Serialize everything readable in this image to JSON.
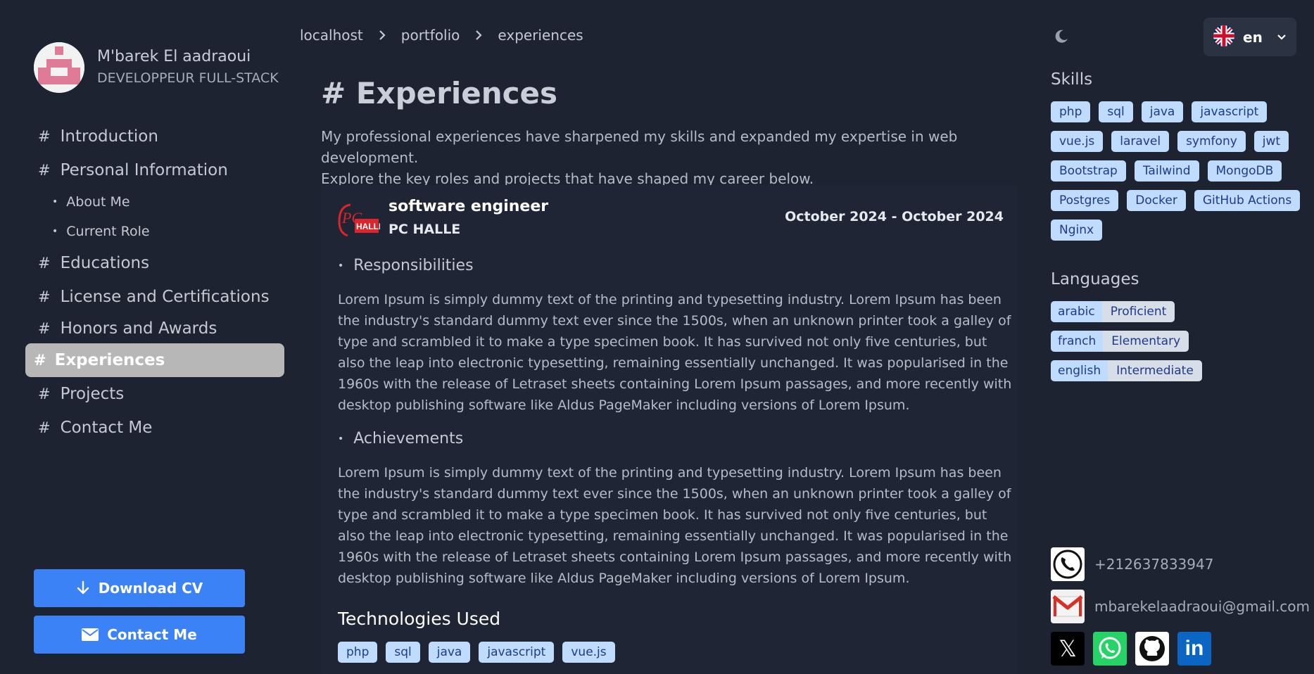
{
  "profile": {
    "name": "M'barek El aadraoui",
    "role": "DEVELOPPEUR FULL-STACK"
  },
  "nav": {
    "hash": "#",
    "bullet": "•",
    "items": [
      {
        "label": "Introduction"
      },
      {
        "label": "Personal Information"
      },
      {
        "label": "About Me"
      },
      {
        "label": "Current Role"
      },
      {
        "label": "Educations"
      },
      {
        "label": "License and Certifications"
      },
      {
        "label": "Honors and Awards"
      },
      {
        "label": "Experiences",
        "active": true
      },
      {
        "label": "Projects"
      },
      {
        "label": "Contact Me"
      }
    ]
  },
  "actions": {
    "download_label": "Download CV",
    "contact_label": "Contact Me"
  },
  "breadcrumb": [
    "localhost",
    "portfolio",
    "experiences"
  ],
  "language_selector": {
    "code": "en"
  },
  "page": {
    "title": "# Experiences",
    "intro_line1": "My professional experiences have sharpened my skills and expanded my expertise in web development.",
    "intro_line2": "Explore the key roles and projects that have shaped my career below."
  },
  "experience": {
    "title": "software engineer",
    "company": "PC HALLE",
    "logo_text_top": "PC",
    "logo_text": "HALLE",
    "dates": "October 2024 - October 2024",
    "responsibilities_heading": "Responsibilities",
    "responsibilities_lines": [
      "Lorem Ipsum is simply dummy text of the printing and typesetting industry. Lorem Ipsum has been",
      "the industry's standard dummy text ever since the 1500s, when an unknown printer took a galley of",
      "type and scrambled it to make a type specimen book. It has survived not only five centuries, but",
      "also the leap into electronic typesetting, remaining essentially unchanged. It was popularised in the",
      "1960s with the release of Letraset sheets containing Lorem Ipsum passages, and more recently with",
      "desktop publishing software like Aldus PageMaker including versions of Lorem Ipsum."
    ],
    "achievements_heading": "Achievements",
    "achievements_lines": [
      "Lorem Ipsum is simply dummy text of the printing and typesetting industry. Lorem Ipsum has been",
      "the industry's standard dummy text ever since the 1500s, when an unknown printer took a galley of",
      "type and scrambled it to make a type specimen book. It has survived not only five centuries, but",
      "also the leap into electronic typesetting, remaining essentially unchanged. It was popularised in the",
      "1960s with the release of Letraset sheets containing Lorem Ipsum passages, and more recently with",
      "desktop publishing software like Aldus PageMaker including versions of Lorem Ipsum."
    ],
    "technologies_heading": "Technologies Used",
    "technologies": [
      "php",
      "sql",
      "java",
      "javascript",
      "vue.js"
    ]
  },
  "skills": {
    "title": "Skills",
    "items": [
      "php",
      "sql",
      "java",
      "javascript",
      "vue.js",
      "laravel",
      "symfony",
      "jwt",
      "Bootstrap",
      "Tailwind",
      "MongoDB",
      "Postgres",
      "Docker",
      "GitHub Actions",
      "Nginx"
    ]
  },
  "languages": {
    "title": "Languages",
    "items": [
      {
        "name": "arabic",
        "level": "Proficient"
      },
      {
        "name": "franch",
        "level": "Elementary"
      },
      {
        "name": "english",
        "level": "Intermediate"
      }
    ]
  },
  "contact": {
    "phone": "+212637833947",
    "email": "mbarekelaadraoui@gmail.com",
    "x_glyph": "𝕏",
    "linkedin_glyph": "in"
  },
  "colors": {
    "background": "#1d2330",
    "accent": "#3b82f6",
    "tag_bg": "#bfdbfe",
    "tag_text": "#1e3a8a",
    "active_nav": "#b7b7b7"
  }
}
